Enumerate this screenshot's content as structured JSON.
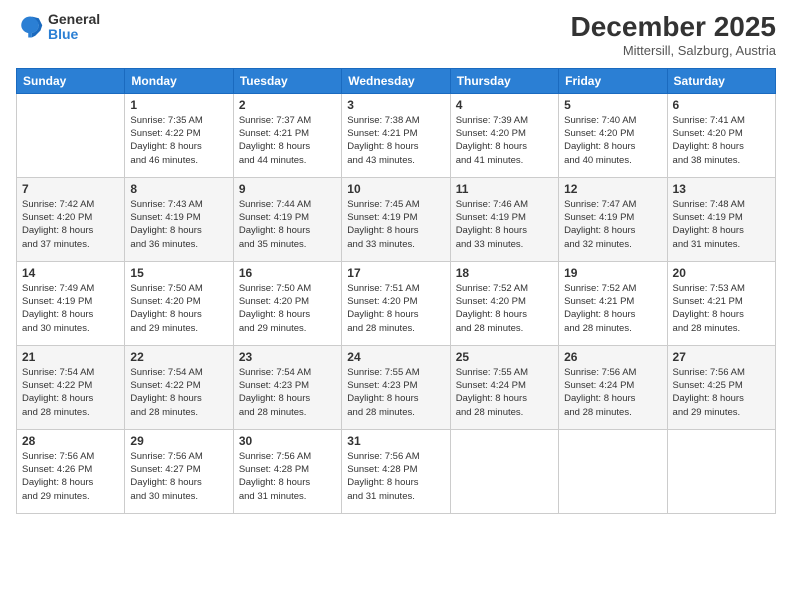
{
  "logo": {
    "general": "General",
    "blue": "Blue"
  },
  "header": {
    "month": "December 2025",
    "location": "Mittersill, Salzburg, Austria"
  },
  "weekdays": [
    "Sunday",
    "Monday",
    "Tuesday",
    "Wednesday",
    "Thursday",
    "Friday",
    "Saturday"
  ],
  "weeks": [
    [
      {
        "date": "",
        "info": ""
      },
      {
        "date": "1",
        "info": "Sunrise: 7:35 AM\nSunset: 4:22 PM\nDaylight: 8 hours\nand 46 minutes."
      },
      {
        "date": "2",
        "info": "Sunrise: 7:37 AM\nSunset: 4:21 PM\nDaylight: 8 hours\nand 44 minutes."
      },
      {
        "date": "3",
        "info": "Sunrise: 7:38 AM\nSunset: 4:21 PM\nDaylight: 8 hours\nand 43 minutes."
      },
      {
        "date": "4",
        "info": "Sunrise: 7:39 AM\nSunset: 4:20 PM\nDaylight: 8 hours\nand 41 minutes."
      },
      {
        "date": "5",
        "info": "Sunrise: 7:40 AM\nSunset: 4:20 PM\nDaylight: 8 hours\nand 40 minutes."
      },
      {
        "date": "6",
        "info": "Sunrise: 7:41 AM\nSunset: 4:20 PM\nDaylight: 8 hours\nand 38 minutes."
      }
    ],
    [
      {
        "date": "7",
        "info": "Sunrise: 7:42 AM\nSunset: 4:20 PM\nDaylight: 8 hours\nand 37 minutes."
      },
      {
        "date": "8",
        "info": "Sunrise: 7:43 AM\nSunset: 4:19 PM\nDaylight: 8 hours\nand 36 minutes."
      },
      {
        "date": "9",
        "info": "Sunrise: 7:44 AM\nSunset: 4:19 PM\nDaylight: 8 hours\nand 35 minutes."
      },
      {
        "date": "10",
        "info": "Sunrise: 7:45 AM\nSunset: 4:19 PM\nDaylight: 8 hours\nand 33 minutes."
      },
      {
        "date": "11",
        "info": "Sunrise: 7:46 AM\nSunset: 4:19 PM\nDaylight: 8 hours\nand 33 minutes."
      },
      {
        "date": "12",
        "info": "Sunrise: 7:47 AM\nSunset: 4:19 PM\nDaylight: 8 hours\nand 32 minutes."
      },
      {
        "date": "13",
        "info": "Sunrise: 7:48 AM\nSunset: 4:19 PM\nDaylight: 8 hours\nand 31 minutes."
      }
    ],
    [
      {
        "date": "14",
        "info": "Sunrise: 7:49 AM\nSunset: 4:19 PM\nDaylight: 8 hours\nand 30 minutes."
      },
      {
        "date": "15",
        "info": "Sunrise: 7:50 AM\nSunset: 4:20 PM\nDaylight: 8 hours\nand 29 minutes."
      },
      {
        "date": "16",
        "info": "Sunrise: 7:50 AM\nSunset: 4:20 PM\nDaylight: 8 hours\nand 29 minutes."
      },
      {
        "date": "17",
        "info": "Sunrise: 7:51 AM\nSunset: 4:20 PM\nDaylight: 8 hours\nand 28 minutes."
      },
      {
        "date": "18",
        "info": "Sunrise: 7:52 AM\nSunset: 4:20 PM\nDaylight: 8 hours\nand 28 minutes."
      },
      {
        "date": "19",
        "info": "Sunrise: 7:52 AM\nSunset: 4:21 PM\nDaylight: 8 hours\nand 28 minutes."
      },
      {
        "date": "20",
        "info": "Sunrise: 7:53 AM\nSunset: 4:21 PM\nDaylight: 8 hours\nand 28 minutes."
      }
    ],
    [
      {
        "date": "21",
        "info": "Sunrise: 7:54 AM\nSunset: 4:22 PM\nDaylight: 8 hours\nand 28 minutes."
      },
      {
        "date": "22",
        "info": "Sunrise: 7:54 AM\nSunset: 4:22 PM\nDaylight: 8 hours\nand 28 minutes."
      },
      {
        "date": "23",
        "info": "Sunrise: 7:54 AM\nSunset: 4:23 PM\nDaylight: 8 hours\nand 28 minutes."
      },
      {
        "date": "24",
        "info": "Sunrise: 7:55 AM\nSunset: 4:23 PM\nDaylight: 8 hours\nand 28 minutes."
      },
      {
        "date": "25",
        "info": "Sunrise: 7:55 AM\nSunset: 4:24 PM\nDaylight: 8 hours\nand 28 minutes."
      },
      {
        "date": "26",
        "info": "Sunrise: 7:56 AM\nSunset: 4:24 PM\nDaylight: 8 hours\nand 28 minutes."
      },
      {
        "date": "27",
        "info": "Sunrise: 7:56 AM\nSunset: 4:25 PM\nDaylight: 8 hours\nand 29 minutes."
      }
    ],
    [
      {
        "date": "28",
        "info": "Sunrise: 7:56 AM\nSunset: 4:26 PM\nDaylight: 8 hours\nand 29 minutes."
      },
      {
        "date": "29",
        "info": "Sunrise: 7:56 AM\nSunset: 4:27 PM\nDaylight: 8 hours\nand 30 minutes."
      },
      {
        "date": "30",
        "info": "Sunrise: 7:56 AM\nSunset: 4:28 PM\nDaylight: 8 hours\nand 31 minutes."
      },
      {
        "date": "31",
        "info": "Sunrise: 7:56 AM\nSunset: 4:28 PM\nDaylight: 8 hours\nand 31 minutes."
      },
      {
        "date": "",
        "info": ""
      },
      {
        "date": "",
        "info": ""
      },
      {
        "date": "",
        "info": ""
      }
    ]
  ]
}
